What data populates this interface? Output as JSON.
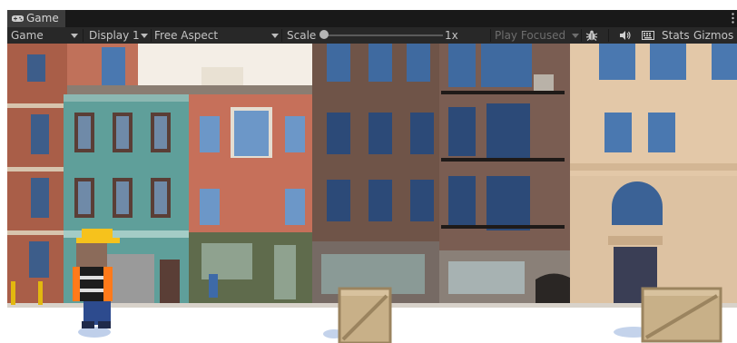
{
  "tab": {
    "label": "Game",
    "icon": "gamepad-icon"
  },
  "toolbar": {
    "display_mode": "Game",
    "display": "Display 1",
    "aspect": "Free Aspect",
    "scale_label": "Scale",
    "scale_value": "1x",
    "scale_level": 0.0,
    "play_focused": "Play Focused",
    "bug_icon": "bug-icon",
    "audio_icon": "speaker-icon",
    "keyboard_icon": "keyboard-icon",
    "stats": "Stats",
    "gizmos": "Gizmos"
  },
  "colors": {
    "tab_bg": "#3c3c3c",
    "toolbar_bg": "#282828",
    "text": "#c4c4c4",
    "sky": "#f7f1ea",
    "ground": "#ffffff",
    "helmet": "#f6c21c",
    "vest": "#ff7a1a",
    "crate": "#c8b088"
  }
}
